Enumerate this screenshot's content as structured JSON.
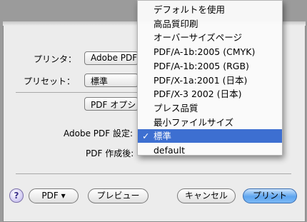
{
  "dialog": {
    "printer_label": "プリンタ：",
    "printer_value": "Adobe PDF",
    "preset_label": "プリセット：",
    "preset_value": "標準",
    "pane_value": "PDF オプション",
    "adobe_setting_label": "Adobe PDF 設定:",
    "after_label": "PDF 作成後:"
  },
  "footer": {
    "help": "?",
    "pdf_button": "PDF ▾",
    "preview_button": "プレビュー",
    "cancel_button": "キャンセル",
    "print_button": "プリント"
  },
  "menu": {
    "check_mark": "✓",
    "items": [
      "デフォルトを使用",
      "高品質印刷",
      "オーバーサイズページ",
      "PDF/A-1b:2005 (CMYK)",
      "PDF/A-1b:2005 (RGB)",
      "PDF/X-1a:2001 (日本)",
      "PDF/X-3 2002 (日本)",
      "プレス品質",
      "最小ファイルサイズ",
      "標準",
      "default"
    ],
    "selected_index": 9
  },
  "colors": {
    "selection": "#3d6fd1",
    "primary_button": "#5ea5ef"
  }
}
